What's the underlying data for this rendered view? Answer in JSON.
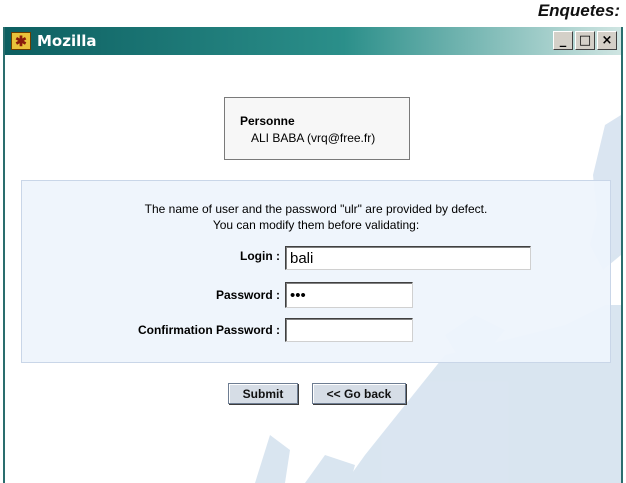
{
  "caption": "Enquetes:",
  "window": {
    "title": "Mozilla",
    "minimize_glyph": "_",
    "maximize_glyph": "□",
    "close_glyph": "×"
  },
  "person": {
    "title": "Personne",
    "name": "ALI BABA (vrq@free.fr)"
  },
  "info": {
    "line1": "The name of user and the password \"ulr\" are provided by defect.",
    "line2": "You can modify them before validating:"
  },
  "form": {
    "login_label": "Login :",
    "login_value": "bali",
    "password_label": "Password :",
    "password_value": "***",
    "confirm_label": "Confirmation Password :",
    "confirm_value": ""
  },
  "buttons": {
    "submit": "Submit",
    "go_back": "<< Go back"
  },
  "colors": {
    "title_bar": "#0d5f61",
    "panel_bg": "#eef4fc",
    "button_bg": "#d6dde6"
  }
}
